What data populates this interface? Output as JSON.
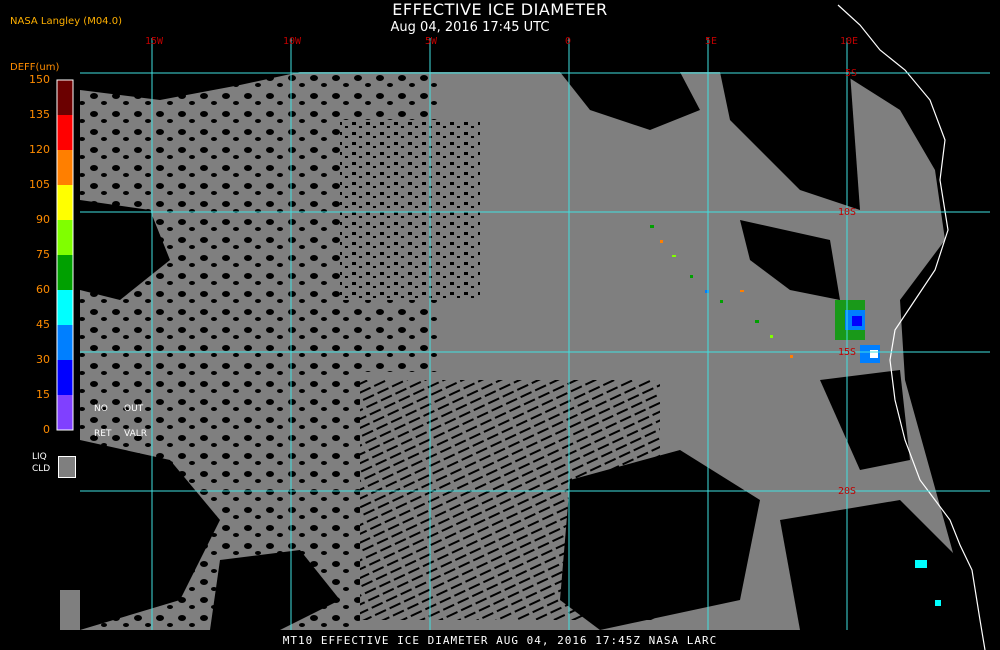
{
  "header": {
    "title": "EFFECTIVE ICE DIAMETER",
    "subtitle": "Aug 04, 2016 17:45 UTC",
    "agency": "NASA Langley (M04.0)"
  },
  "legend": {
    "unit_label": "DEFF(um)",
    "ticks": [
      "150",
      "135",
      "120",
      "105",
      "90",
      "75",
      "60",
      "45",
      "30",
      "15",
      "0"
    ],
    "colors": [
      "#6b0000",
      "#ff0000",
      "#ff7f00",
      "#ffff00",
      "#80ff00",
      "#00a000",
      "#00ffff",
      "#007fff",
      "#0000ff",
      "#8040ff"
    ],
    "note_no": "NO",
    "note_out": "OUT",
    "note_ret": "RET",
    "note_valr": "VALR",
    "liq_line1": "LIQ",
    "liq_line2": "CLD",
    "liq_color": "#7f7f7f"
  },
  "grid": {
    "lon_labels": [
      "15W",
      "10W",
      "5W",
      "0",
      "5E",
      "10E"
    ],
    "lat_labels": [
      "5S",
      "10S",
      "15S",
      "20S"
    ],
    "line_color": "#40e0e0",
    "label_color": "#c00000"
  },
  "footer": {
    "text": "MT10  EFFECTIVE ICE DIAMETER   AUG 04, 2016 17:45Z   NASA LARC"
  }
}
